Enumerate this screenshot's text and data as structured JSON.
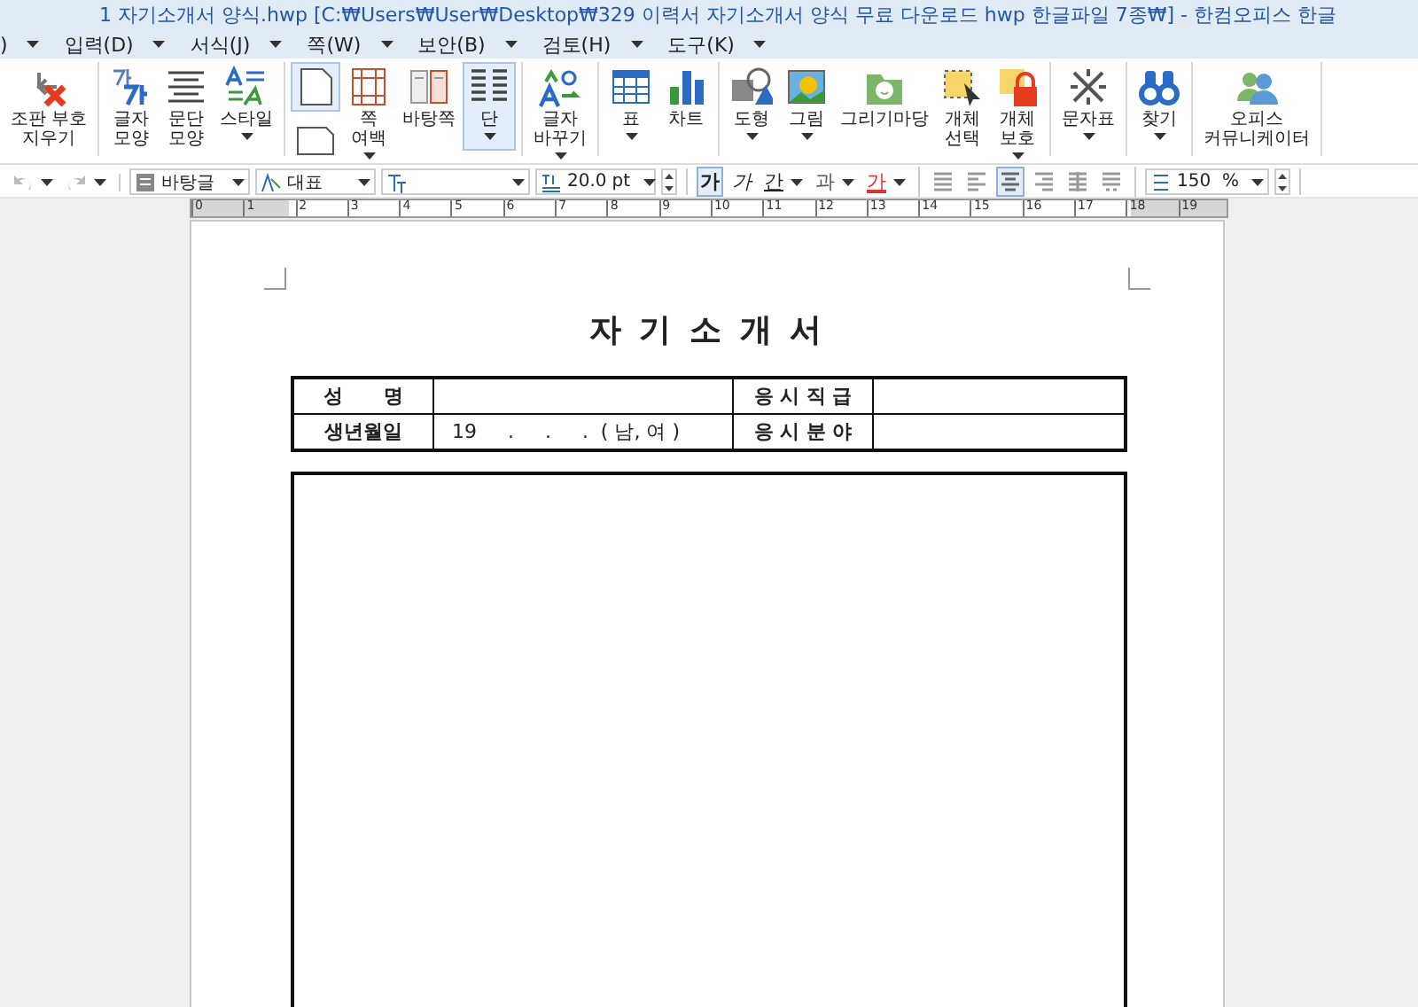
{
  "window": {
    "title": "1 자기소개서 양식.hwp [C:₩Users₩User₩Desktop₩329 이력서 자기소개서 양식 무료 다운로드 hwp 한글파일 7종₩] - 한컴오피스 한글"
  },
  "menu": [
    {
      "label": ")"
    },
    {
      "label": "입력(D)"
    },
    {
      "label": "서식(J)"
    },
    {
      "label": "쪽(W)"
    },
    {
      "label": "보안(B)"
    },
    {
      "label": "검토(H)"
    },
    {
      "label": "도구(K)"
    }
  ],
  "ribbon": {
    "groups": [
      {
        "items": [
          {
            "kind": "button",
            "label": "조판 부호\n지우기",
            "dropdown": false,
            "selected": false
          }
        ]
      },
      {
        "items": [
          {
            "kind": "button",
            "label": "글자\n모양",
            "dropdown": false,
            "selected": false
          },
          {
            "kind": "button",
            "label": "문단\n모양",
            "dropdown": false,
            "selected": false
          },
          {
            "kind": "button",
            "label": "스타일",
            "dropdown": true,
            "selected": false
          }
        ]
      },
      {
        "items": [
          {
            "kind": "pair",
            "parts": [
              {
                "selected": true
              },
              {
                "selected": false
              }
            ]
          },
          {
            "kind": "button",
            "label": "쪽\n여백",
            "dropdown": true,
            "selected": false
          },
          {
            "kind": "button",
            "label": "바탕쪽",
            "dropdown": false,
            "selected": false
          },
          {
            "kind": "button",
            "label": "단",
            "dropdown": true,
            "selected": true
          }
        ]
      },
      {
        "items": [
          {
            "kind": "button",
            "label": "글자\n바꾸기",
            "dropdown": true,
            "selected": false
          }
        ]
      },
      {
        "items": [
          {
            "kind": "button",
            "label": "표",
            "dropdown": true,
            "selected": false
          },
          {
            "kind": "button",
            "label": "차트",
            "dropdown": false,
            "selected": false
          }
        ]
      },
      {
        "items": [
          {
            "kind": "button",
            "label": "도형",
            "dropdown": true,
            "selected": false
          },
          {
            "kind": "button",
            "label": "그림",
            "dropdown": true,
            "selected": false
          },
          {
            "kind": "button",
            "label": "그리기마당",
            "dropdown": false,
            "selected": false
          },
          {
            "kind": "button",
            "label": "개체\n선택",
            "dropdown": false,
            "selected": false
          },
          {
            "kind": "button",
            "label": "개체\n보호",
            "dropdown": true,
            "selected": false
          }
        ]
      },
      {
        "items": [
          {
            "kind": "button",
            "label": "문자표",
            "dropdown": true,
            "selected": false
          }
        ]
      },
      {
        "items": [
          {
            "kind": "button",
            "label": "찾기",
            "dropdown": true,
            "selected": false
          }
        ]
      },
      {
        "items": [
          {
            "kind": "button",
            "label": "오피스\n커뮤니케이터",
            "dropdown": false,
            "selected": false
          }
        ]
      }
    ]
  },
  "toolbar": {
    "groups": [
      [
        {
          "kind": "tool",
          "disabled": true,
          "dropdown": true
        },
        {
          "kind": "tool",
          "disabled": true,
          "dropdown": true
        }
      ],
      [
        {
          "kind": "combo",
          "value": "바탕글"
        },
        {
          "kind": "combo",
          "value": "대표"
        },
        {
          "kind": "combo"
        },
        {
          "kind": "combo",
          "value": "20.0",
          "unit": "pt"
        },
        {
          "kind": "spin"
        }
      ],
      [
        {
          "kind": "char",
          "label": "가",
          "selected": true,
          "dropdown": false
        },
        {
          "kind": "char",
          "label": "가",
          "selected": false,
          "dropdown": false
        },
        {
          "kind": "char",
          "label": "간",
          "selected": false,
          "dropdown": true
        },
        {
          "kind": "char",
          "label": "과",
          "selected": false,
          "dropdown": true
        },
        {
          "kind": "char",
          "label": "가",
          "selected": false,
          "dropdown": true
        }
      ],
      [
        {
          "kind": "align",
          "selected": false
        },
        {
          "kind": "align",
          "selected": false
        },
        {
          "kind": "align",
          "selected": true
        },
        {
          "kind": "align",
          "selected": false
        },
        {
          "kind": "align",
          "selected": false
        },
        {
          "kind": "align",
          "selected": false
        }
      ],
      [
        {
          "kind": "combo",
          "value": "150",
          "unit": "%"
        },
        {
          "kind": "spin"
        }
      ]
    ]
  },
  "ruler": {
    "labels": [
      "0",
      "1",
      "2",
      "3",
      "4",
      "5",
      "6",
      "7",
      "8",
      "9",
      "10",
      "11",
      "12",
      "13",
      "14",
      "15",
      "16",
      "17",
      "18",
      "19"
    ]
  },
  "document": {
    "title": "자 기 소 개 서",
    "table": {
      "rows": [
        {
          "label_1": "성      명",
          "label_2": "응 시 직 급"
        },
        {
          "label_1": "생년월일",
          "value_1": "19     .     .     .  ( 남, 여 )",
          "label_2": "응 시 분 야"
        }
      ]
    }
  }
}
